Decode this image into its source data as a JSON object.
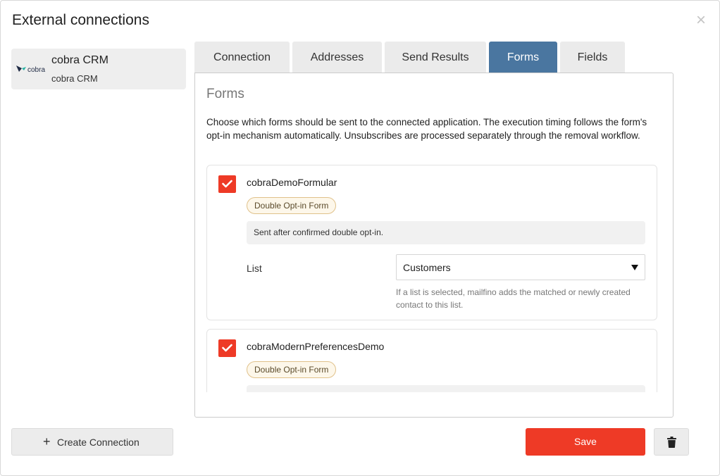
{
  "dialog": {
    "title": "External connections",
    "close_icon": "close-icon"
  },
  "connection": {
    "name": "cobra CRM",
    "subtitle": "cobra CRM",
    "logo_text": "cobra"
  },
  "tabs": [
    {
      "label": "Connection",
      "active": false
    },
    {
      "label": "Addresses",
      "active": false
    },
    {
      "label": "Send Results",
      "active": false
    },
    {
      "label": "Forms",
      "active": true
    },
    {
      "label": "Fields",
      "active": false
    }
  ],
  "forms_panel": {
    "heading": "Forms",
    "description": "Choose which forms should be sent to the connected application. The execution timing follows the form's opt-in mechanism automatically. Unsubscribes are processed separately through the removal workflow.",
    "items": [
      {
        "checked": true,
        "name": "cobraDemoFormular",
        "badge": "Double Opt-in Form",
        "info": "Sent after confirmed double opt-in.",
        "list_label": "List",
        "list_value": "Customers",
        "help": "If a list is selected, mailfino adds the matched or newly created contact to this list."
      },
      {
        "checked": true,
        "name": "cobraModernPreferencesDemo",
        "badge": "Double Opt-in Form"
      }
    ]
  },
  "footer": {
    "create_label": "Create Connection",
    "create_icon": "+",
    "save_label": "Save",
    "delete_icon": "trash-icon"
  },
  "colors": {
    "accent": "#ee3a26",
    "active_tab": "#4a76a0",
    "badge_border": "#e0c18a"
  }
}
